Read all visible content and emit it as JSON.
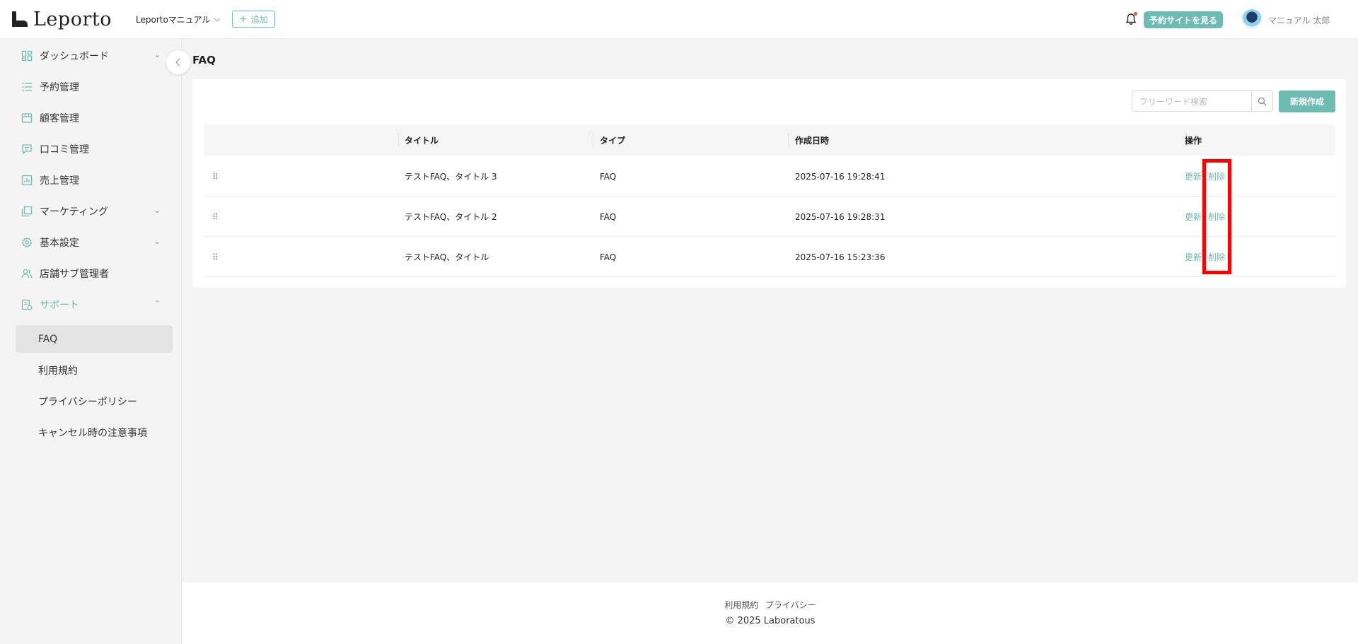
{
  "header": {
    "logo_text": "Leporto",
    "store_name": "Leportoマニュアル",
    "add_label": "追加",
    "view_site_label": "予約サイトを見る",
    "user_name": "マニュアル 太郎"
  },
  "sidebar": {
    "items": [
      {
        "label": "ダッシュボード",
        "icon": "dashboard-icon"
      },
      {
        "label": "予約管理",
        "icon": "list-icon"
      },
      {
        "label": "顧客管理",
        "icon": "store-icon"
      },
      {
        "label": "口コミ管理",
        "icon": "comment-icon"
      },
      {
        "label": "売上管理",
        "icon": "chart-icon"
      },
      {
        "label": "マーケティング",
        "icon": "copy-icon"
      },
      {
        "label": "基本設定",
        "icon": "gear-icon"
      },
      {
        "label": "店舗サブ管理者",
        "icon": "users-icon"
      },
      {
        "label": "サポート",
        "icon": "support-icon"
      }
    ],
    "sub_items": [
      {
        "label": "FAQ"
      },
      {
        "label": "利用規約"
      },
      {
        "label": "プライバシーポリシー"
      },
      {
        "label": "キャンセル時の注意事項"
      }
    ]
  },
  "main": {
    "page_title": "FAQ",
    "search_placeholder": "フリーワード検索",
    "new_button": "新規作成",
    "columns": [
      "タイトル",
      "タイプ",
      "作成日時",
      "操作"
    ],
    "rows": [
      {
        "title": "テストFAQ、タイトル 3",
        "type": "FAQ",
        "created": "2025-07-16 19:28:41",
        "update": "更新",
        "delete": "削除"
      },
      {
        "title": "テストFAQ、タイトル 2",
        "type": "FAQ",
        "created": "2025-07-16 19:28:31",
        "update": "更新",
        "delete": "削除"
      },
      {
        "title": "テストFAQ、タイトル",
        "type": "FAQ",
        "created": "2025-07-16 15:23:36",
        "update": "更新",
        "delete": "削除"
      }
    ]
  },
  "footer": {
    "terms": "利用規約",
    "privacy": "プライバシー",
    "copyright": "2025 Laboratous"
  },
  "colors": {
    "accent": "#6dbcb3",
    "highlight": "#ff0000"
  }
}
